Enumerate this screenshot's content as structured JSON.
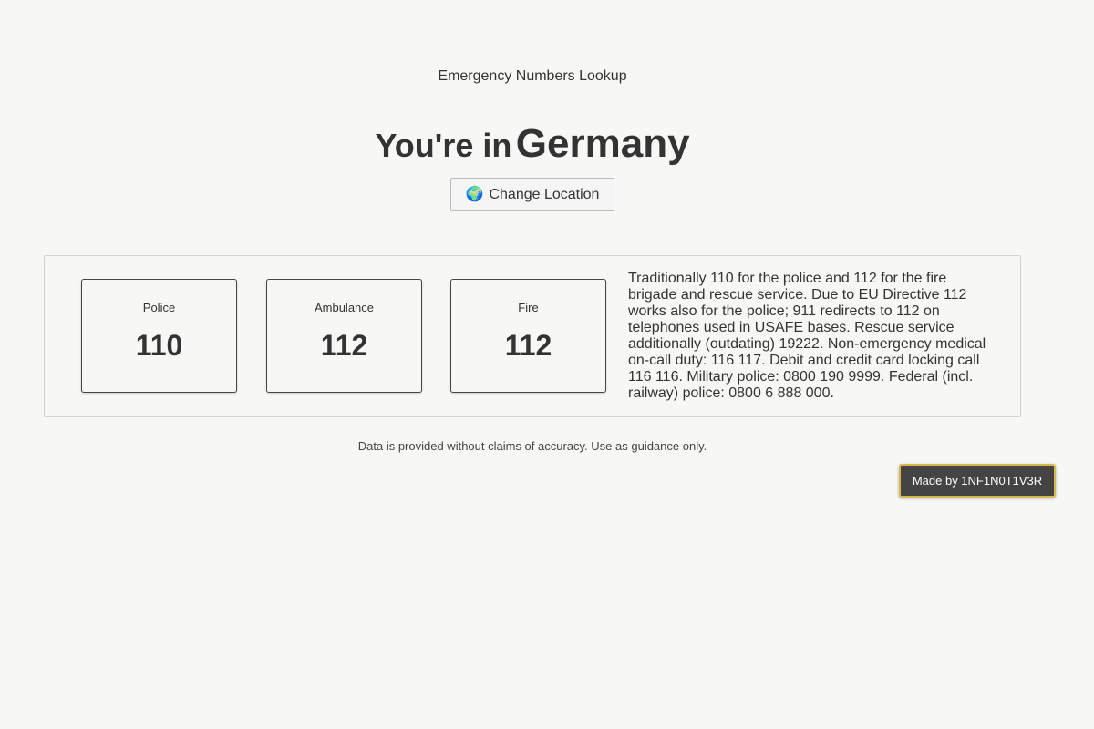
{
  "header": {
    "app_title": "Emergency Numbers Lookup",
    "headline_prefix": "You're in",
    "country": "Germany",
    "change_location_label": "Change Location",
    "change_location_icon": "globe-icon"
  },
  "numbers": [
    {
      "label": "Police",
      "value": "110"
    },
    {
      "label": "Ambulance",
      "value": "112"
    },
    {
      "label": "Fire",
      "value": "112"
    }
  ],
  "info_text": "Traditionally 110 for the police and 112 for the fire brigade and rescue service. Due to EU Directive 112 works also for the police; 911 redirects to 112 on telephones used in USAFE bases. Rescue service additionally (outdating) 19222. Non-emergency medical on-call duty: 116 117. Debit and credit card locking call 116 116. Military police: 0800 190 9999. Federal (incl. railway) police: 0800 6 888 000.",
  "footer": {
    "disclaimer": "Data is provided without claims of accuracy. Use as guidance only.",
    "made_by": "Made by 1NF1N0T1V3R"
  },
  "colors": {
    "background": "#f7f7f5",
    "text": "#333333",
    "badge_background": "#444444",
    "badge_border": "#d8b84a"
  }
}
